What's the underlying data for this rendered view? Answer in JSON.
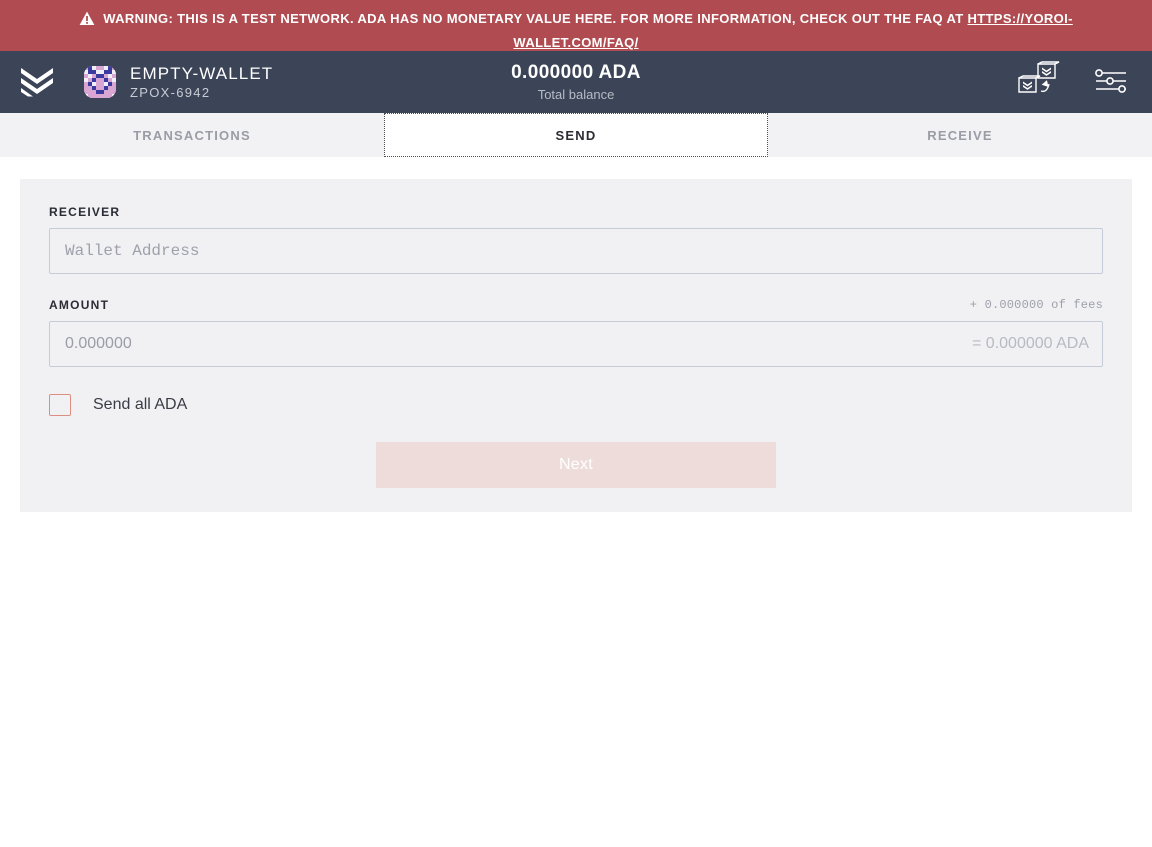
{
  "banner": {
    "icon": "warning-triangle-icon",
    "text_before": "WARNING: THIS IS A TEST NETWORK. ADA HAS NO MONETARY VALUE HERE. FOR MORE INFORMATION, CHECK OUT THE FAQ AT ",
    "link_text": "HTTPS://YOROI-WALLET.COM/FAQ/",
    "bg_color": "#b04c51"
  },
  "navbar": {
    "logo_icon": "yoroi-chevron-logo-icon",
    "wallet": {
      "avatar_icon": "wallet-identicon-avatar",
      "name": "EMPTY-WALLET",
      "plate_id": "ZPOX-6942"
    },
    "balance": {
      "amount": "0.000000 ADA",
      "label": "Total balance"
    },
    "actions": [
      {
        "icon": "wallet-switch-icon",
        "name": "switch-wallet-button"
      },
      {
        "icon": "settings-sliders-icon",
        "name": "settings-button"
      }
    ],
    "bg_color": "#3c4557",
    "indicator_color": "#d9a2a0"
  },
  "tabs": [
    {
      "label": "TRANSACTIONS",
      "name": "tab-transactions",
      "active": false
    },
    {
      "label": "SEND",
      "name": "tab-send",
      "active": true
    },
    {
      "label": "RECEIVE",
      "name": "tab-receive",
      "active": false
    }
  ],
  "send_form": {
    "receiver": {
      "label": "RECEIVER",
      "placeholder": "Wallet Address",
      "value": ""
    },
    "amount": {
      "label": "AMOUNT",
      "placeholder": "0.000000",
      "value": "",
      "fees_note": "+ 0.000000 of fees",
      "total": "= 0.000000 ADA"
    },
    "send_all": {
      "label": "Send all ADA",
      "checked": false
    },
    "submit": {
      "label": "Next",
      "disabled": true
    }
  }
}
